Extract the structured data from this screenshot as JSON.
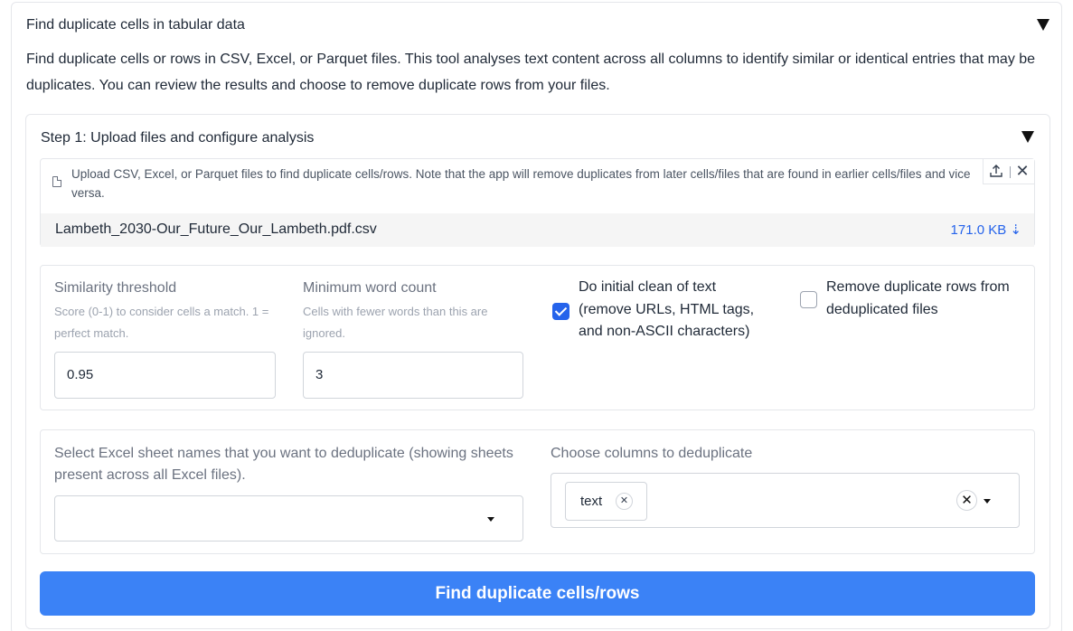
{
  "outer_accordion": {
    "title": "Find duplicate cells in tabular data",
    "description": "Find duplicate cells or rows in CSV, Excel, or Parquet files. This tool analyses text content across all columns to identify similar or identical entries that may be duplicates. You can review the results and choose to remove duplicate rows from your files."
  },
  "step1": {
    "title": "Step 1: Upload files and configure analysis",
    "upload": {
      "instructions": "Upload CSV, Excel, or Parquet files to find duplicate cells/rows. Note that the app will remove duplicates from later cells/files that are found in earlier cells/files and vice versa.",
      "icons": [
        "file-icon",
        "upload-icon",
        "close-icon"
      ],
      "file_name": "Lambeth_2030-Our_Future_Our_Lambeth.pdf.csv",
      "file_size": "171.0 KB ⇣"
    },
    "similarity": {
      "label": "Similarity threshold",
      "info": "Score (0-1) to consider cells a match. 1 = perfect match.",
      "value": "0.95"
    },
    "min_words": {
      "label": "Minimum word count",
      "info": "Cells with fewer words than this are ignored.",
      "value": "3"
    },
    "clean_text": {
      "label": "Do initial clean of text (remove URLs, HTML tags, and non-ASCII characters)",
      "checked": true
    },
    "remove_dupes": {
      "label": "Remove duplicate rows from deduplicated files",
      "checked": false
    },
    "sheets": {
      "label": "Select Excel sheet names that you want to deduplicate (showing sheets present across all Excel files).",
      "value": ""
    },
    "columns": {
      "label": "Choose columns to deduplicate",
      "selected": [
        "text"
      ]
    },
    "run_button": "Find duplicate cells/rows"
  },
  "colors": {
    "accent": "#3b82f6",
    "checkbox": "#2563eb",
    "link": "#2563eb"
  }
}
